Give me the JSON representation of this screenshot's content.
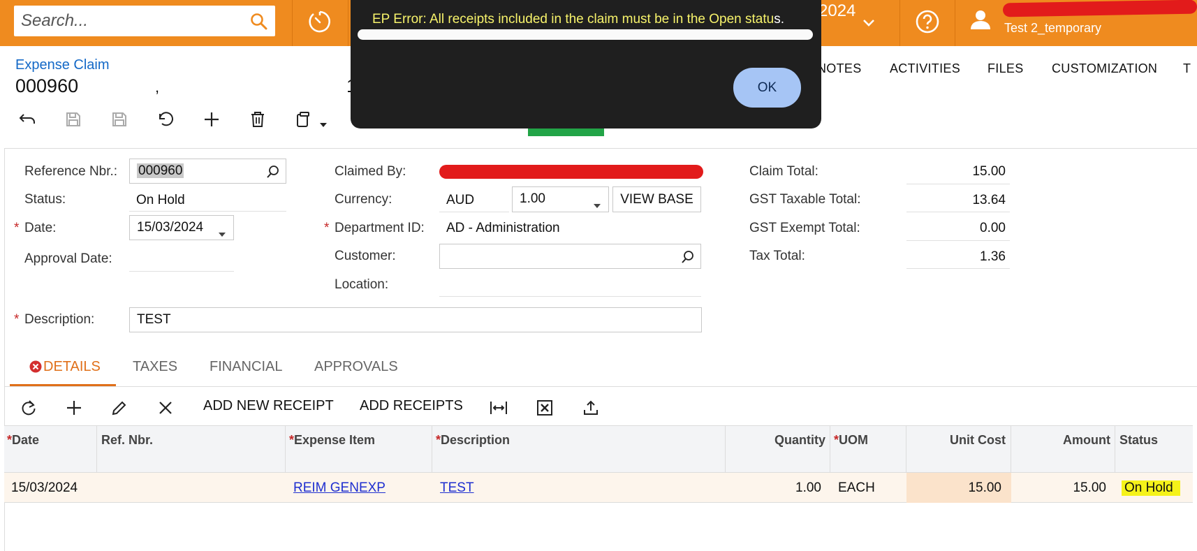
{
  "topbar": {
    "search_placeholder": "Search...",
    "year_fragment": "2024",
    "user_subtitle": "Test 2_temporary"
  },
  "header": {
    "breadcrumb": "Expense Claim",
    "title": "000960",
    "title_tail": ",",
    "title_fragment": "1",
    "tabs": [
      "NOTES",
      "ACTIVITIES",
      "FILES",
      "CUSTOMIZATION",
      "T"
    ]
  },
  "form": {
    "reference_label": "Reference Nbr.:",
    "reference_value": "000960",
    "status_label": "Status:",
    "status_value": "On Hold",
    "date_label": "Date:",
    "date_value": "15/03/2024",
    "approval_date_label": "Approval Date:",
    "description_label": "Description:",
    "description_value": "TEST",
    "claimed_by_label": "Claimed By:",
    "currency_label": "Currency:",
    "currency_value": "AUD",
    "rate_value": "1.00",
    "view_base_label": "VIEW BASE",
    "department_label": "Department ID:",
    "department_value": "AD - Administration",
    "customer_label": "Customer:",
    "location_label": "Location:",
    "claim_total_label": "Claim Total:",
    "claim_total_value": "15.00",
    "gst_taxable_label": "GST Taxable Total:",
    "gst_taxable_value": "13.64",
    "gst_exempt_label": "GST Exempt Total:",
    "gst_exempt_value": "0.00",
    "tax_total_label": "Tax Total:",
    "tax_total_value": "1.36"
  },
  "tabs": {
    "details": "DETAILS",
    "taxes": "TAXES",
    "financial": "FINANCIAL",
    "approvals": "APPROVALS"
  },
  "grid_toolbar": {
    "add_new_receipt": "ADD NEW RECEIPT",
    "add_receipts": "ADD RECEIPTS"
  },
  "table": {
    "columns": {
      "date": "Date",
      "ref_nbr": "Ref. Nbr.",
      "expense_item": "Expense Item",
      "description": "Description",
      "quantity": "Quantity",
      "uom": "UOM",
      "unit_cost": "Unit Cost",
      "amount": "Amount",
      "status": "Status"
    },
    "rows": [
      {
        "date": "15/03/2024",
        "ref_nbr": "",
        "expense_item": "REIM GENEXP",
        "description": "TEST",
        "quantity": "1.00",
        "uom": "EACH",
        "unit_cost": "15.00",
        "amount": "15.00",
        "status": "On Hold"
      }
    ]
  },
  "dialog": {
    "message": "EP Error: All receipts included in the claim must be in the Open statu",
    "message_tail": "s.",
    "ok_label": "OK"
  }
}
